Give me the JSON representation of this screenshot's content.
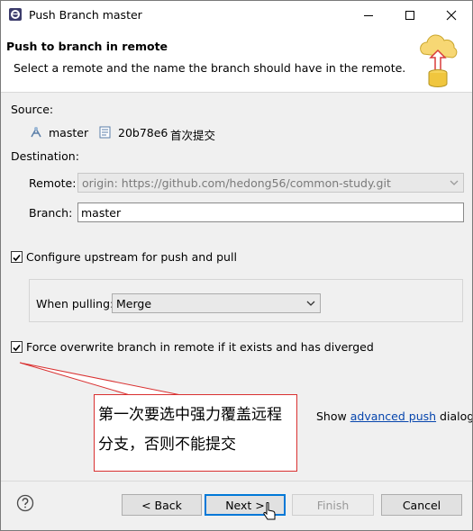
{
  "window": {
    "title": "Push Branch master"
  },
  "header": {
    "title": "Push to branch in remote",
    "description": "Select a remote and the name the branch should have in the remote."
  },
  "source": {
    "label": "Source:",
    "branch": "master",
    "commit_id": "20b78e6",
    "commit_message": "首次提交"
  },
  "destination": {
    "label": "Destination:",
    "remote_label": "Remote:",
    "remote_value": "origin: https://github.com/hedong56/common-study.git",
    "branch_label": "Branch:",
    "branch_value": "master"
  },
  "upstream": {
    "checkbox_label": "Configure upstream for push and pull",
    "checked": true,
    "when_pulling_label": "When pulling:",
    "when_pulling_value": "Merge"
  },
  "force": {
    "checkbox_label": "Force overwrite branch in remote if it exists and has diverged",
    "checked": true
  },
  "annotation": {
    "text": "第一次要选中强力覆盖远程分支，否则不能提交",
    "color": "#d93030"
  },
  "advanced": {
    "prefix": "Show",
    "link": "advanced push",
    "suffix": "dialog"
  },
  "buttons": {
    "back": "< Back",
    "next": "Next >",
    "finish": "Finish",
    "cancel": "Cancel"
  },
  "icons": [
    "eclipse-icon",
    "minimize-icon",
    "maximize-icon",
    "close-icon",
    "push-cloud-icon",
    "branch-icon",
    "commit-icon",
    "chevron-down-icon",
    "help-icon",
    "mouse-cursor-icon"
  ]
}
